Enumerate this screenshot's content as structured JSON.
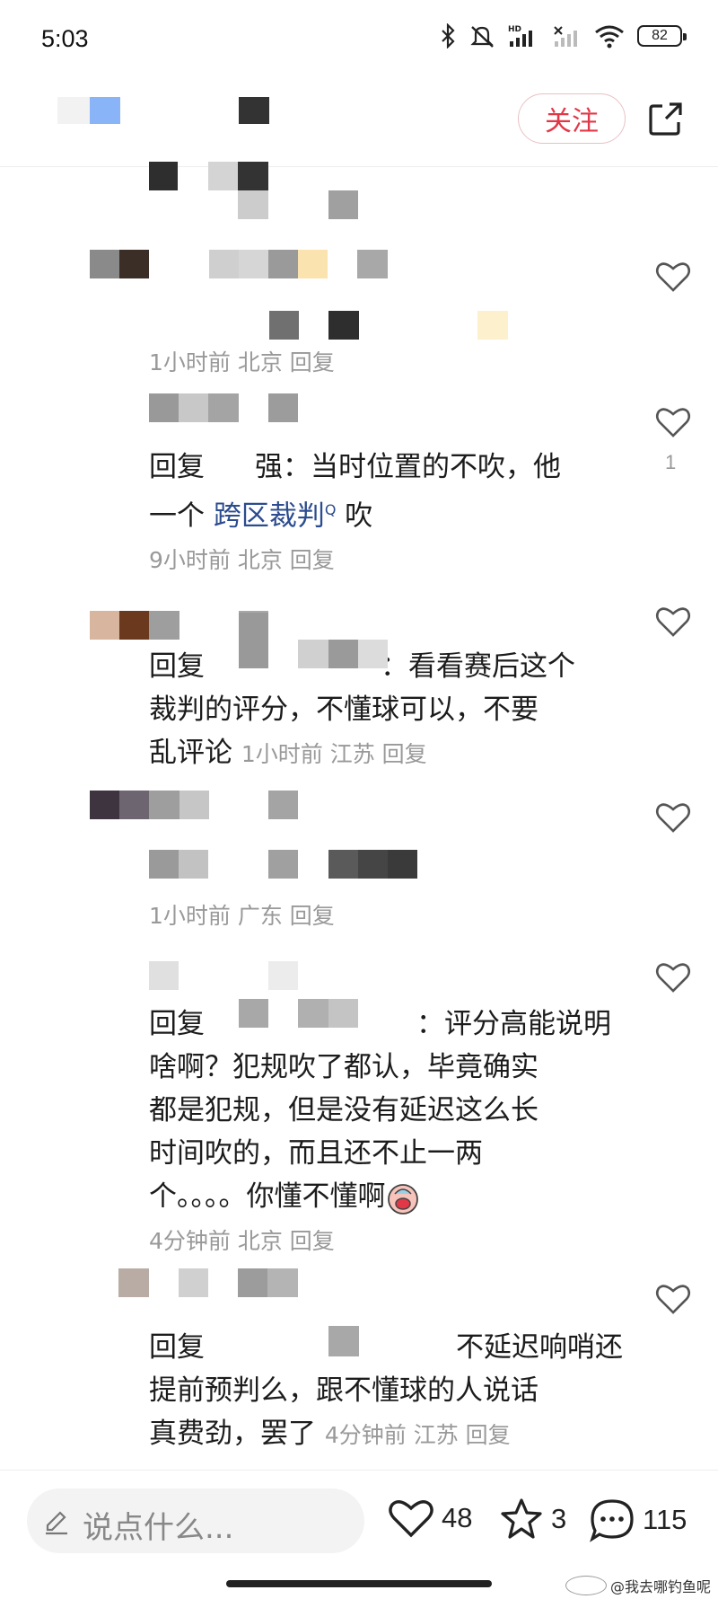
{
  "status_bar": {
    "time": "5:03",
    "battery": "82"
  },
  "header": {
    "follow_label": "关注"
  },
  "comments": [
    {
      "meta": "1小时前 北京 回复"
    },
    {
      "prefix": "回复",
      "suffix": "强：当时位置的不吹，他",
      "line2_start": "一个 ",
      "link": "跨区裁判",
      "line2_end": " 吹",
      "meta": "9小时前 北京 回复",
      "likes": "1"
    },
    {
      "prefix": "回复",
      "suffix": "：看看赛后这个",
      "line2": "裁判的评分，不懂球可以，不要",
      "line3": "乱评论",
      "meta": "1小时前 江苏 回复"
    },
    {
      "meta": "1小时前 广东 回复"
    },
    {
      "prefix": "回复",
      "suffix": "：评分高能说明",
      "line2": "啥啊？犯规吹了都认，毕竟确实",
      "line3": "都是犯规，但是没有延迟这么长",
      "line4": "时间吹的，而且还不止一两",
      "line5": "个。。。。你懂不懂啊",
      "meta": "4分钟前 北京 回复"
    },
    {
      "prefix": "回复",
      "suffix": "不延迟响哨还",
      "line2": "提前预判么，跟不懂球的人说话",
      "line3": "真费劲，罢了",
      "meta": "4分钟前 江苏 回复"
    }
  ],
  "bottom_bar": {
    "input_placeholder": "说点什么...",
    "like_count": "48",
    "fav_count": "3",
    "comment_count": "115"
  },
  "watermark": "@我去哪钓鱼呢",
  "colors": {
    "accent_red": "#e23747",
    "link_blue": "#2c4c8f",
    "meta_gray": "#999999"
  }
}
